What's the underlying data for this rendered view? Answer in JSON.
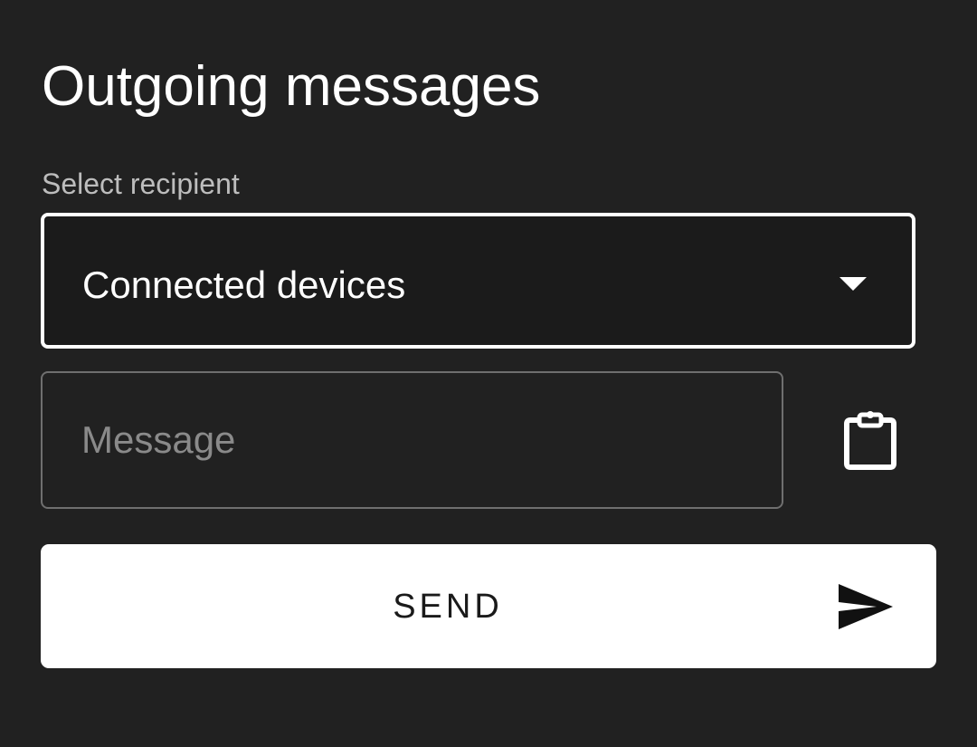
{
  "header": {
    "title": "Outgoing messages"
  },
  "recipient": {
    "label": "Select recipient",
    "selected": "Connected devices",
    "dropdown_icon": "caret-down-icon"
  },
  "message": {
    "placeholder": "Message",
    "value": ""
  },
  "clipboard": {
    "icon": "clipboard-icon"
  },
  "send": {
    "label": "SEND",
    "icon": "send-icon"
  },
  "colors": {
    "background": "#212121",
    "text": "#ffffff",
    "muted_text": "#bdbdbd",
    "placeholder": "#8a8a8a",
    "button_bg": "#ffffff",
    "button_text": "#1a1a1a"
  }
}
